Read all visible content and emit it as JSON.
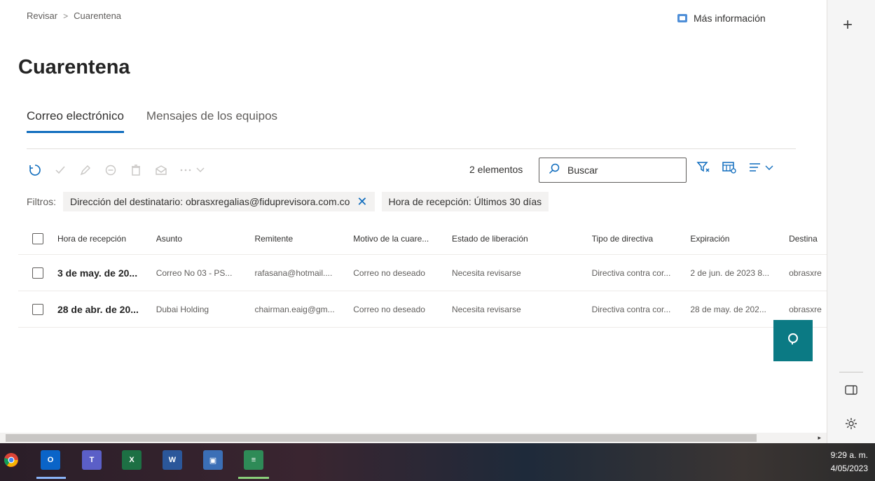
{
  "breadcrumb": {
    "items": [
      "Revisar",
      "Cuarentena"
    ],
    "separator": ">"
  },
  "more_info": "Más información",
  "page_title": "Cuarentena",
  "tabs": [
    {
      "label": "Correo electrónico",
      "active": true
    },
    {
      "label": "Mensajes de los equipos",
      "active": false
    }
  ],
  "toolbar": {
    "icons": [
      "refresh-icon",
      "check-icon",
      "edit-icon",
      "block-icon",
      "delete-icon",
      "mail-icon",
      "more-icon"
    ],
    "count_label": "2 elementos",
    "search_placeholder": "Buscar"
  },
  "filters": {
    "label": "Filtros:",
    "chips": [
      {
        "text": "Dirección del destinatario: obrasxregalias@fiduprevisora.com.co",
        "removable": true
      },
      {
        "text": "Hora de recepción: Últimos 30 días",
        "removable": false
      }
    ]
  },
  "table": {
    "columns": [
      "Hora de recepción",
      "Asunto",
      "Remitente",
      "Motivo de la cuare...",
      "Estado de liberación",
      "Tipo de directiva",
      "Expiración",
      "Destina"
    ],
    "rows": [
      [
        "3 de may. de 20...",
        "Correo No 03 - PS...",
        "rafasana@hotmail....",
        "Correo no deseado",
        "Necesita revisarse",
        "Directiva contra cor...",
        "2 de jun. de 2023 8...",
        "obrasxre"
      ],
      [
        "28 de abr. de 20...",
        "Dubai Holding",
        "chairman.eaig@gm...",
        "Correo no deseado",
        "Necesita revisarse",
        "Directiva contra cor...",
        "28 de may. de 202...",
        "obrasxre"
      ]
    ]
  },
  "taskbar": {
    "apps": [
      "chrome-icon",
      "outlook-icon",
      "teams-icon",
      "excel-icon",
      "word-icon",
      "remote-desktop-icon",
      "notepad-icon"
    ],
    "time": "9:29 a. m.",
    "date": "4/05/2023"
  },
  "colors": {
    "accent": "#0f6cbd",
    "fab": "#0b7a84"
  }
}
